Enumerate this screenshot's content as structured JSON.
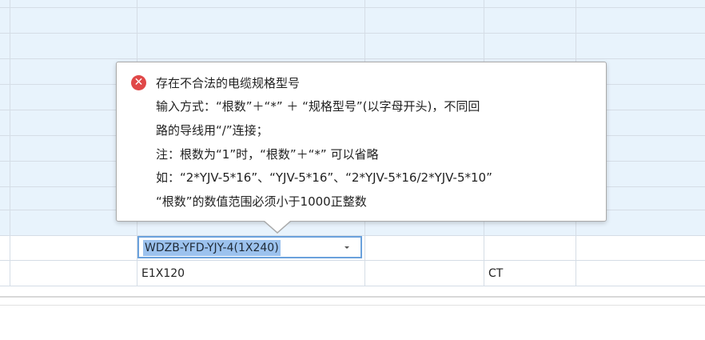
{
  "grid": {
    "row_editing_value": "WDZB-YFD-YJY-4(1X240)",
    "next_row": {
      "col_b": "E1X120",
      "col_d": "CT"
    }
  },
  "validation_tooltip": {
    "icon": "error-x-icon",
    "title": "存在不合法的电缆规格型号",
    "lines": [
      "输入方式：“根数”＋“*” ＋ “规格型号”(以字母开头)，不同回",
      "路的导线用“/”连接；",
      "注：根数为“1”时，“根数”＋“*” 可以省略",
      "如：“2*YJV-5*16”、“YJV-5*16”、“2*YJV-5*16/2*YJV-5*10”",
      "“根数”的数值范围必须小于1000正整数"
    ]
  },
  "colors": {
    "selection_bg": "#e8f3fc",
    "editor_border": "#6aa1dc",
    "text_highlight": "#9cc2ee",
    "error_icon": "#e04848"
  }
}
